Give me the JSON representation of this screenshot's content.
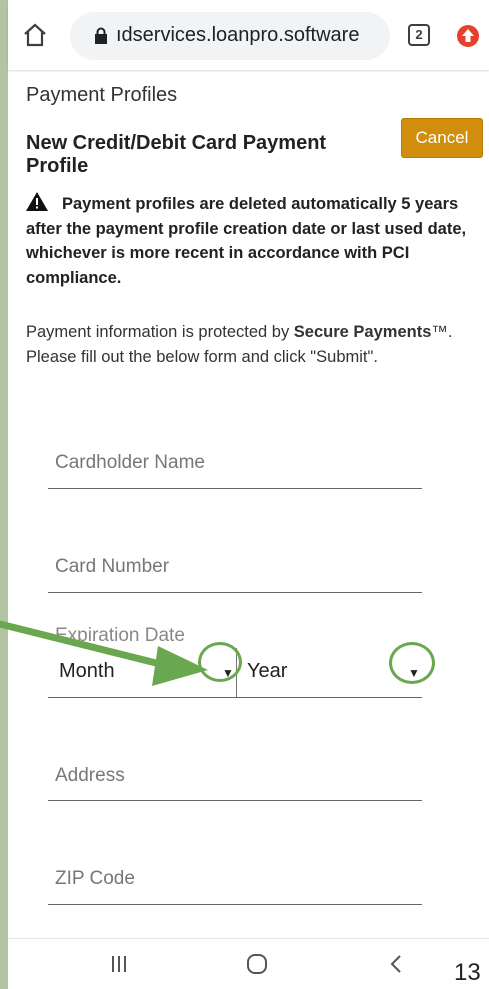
{
  "browser": {
    "url": "ıdservices.loanpro.software",
    "tab_count": "2"
  },
  "page": {
    "heading": "Payment Profiles",
    "form_title": "New Credit/Debit Card Payment Profile",
    "cancel_label": "Cancel",
    "warning_text": "Payment profiles are deleted automatically 5 years after the payment profile creation date or last used date, whichever is more recent in accordance with PCI compliance.",
    "info_prefix": "Payment information is protected by ",
    "info_bold": "Secure Payments",
    "info_suffix": "™. Please fill out the below form and click \"Submit\"."
  },
  "form": {
    "cardholder_label": "Cardholder Name",
    "card_number_label": "Card Number",
    "expiration_label": "Expiration Date",
    "month_value": "Month",
    "year_value": "Year",
    "address_label": "Address",
    "zip_label": "ZIP Code"
  },
  "footer": {
    "page_number": "13"
  },
  "colors": {
    "background": "#b3c4a5",
    "cancel_button": "#d18e0d",
    "annotation": "#6aa84f"
  }
}
